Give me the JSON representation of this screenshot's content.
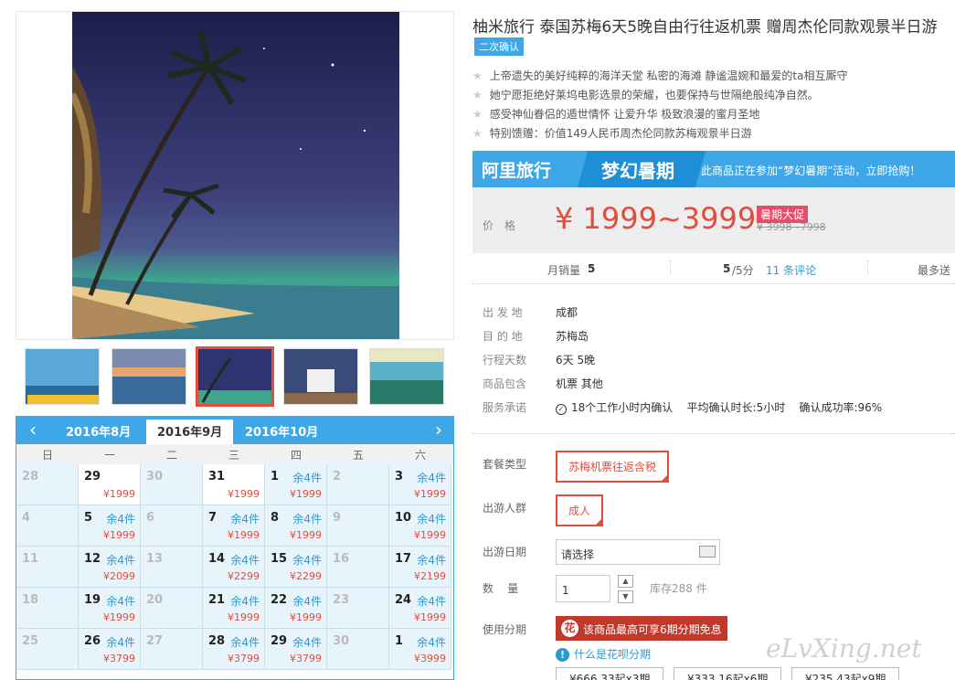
{
  "title": "柚米旅行 泰国苏梅6天5晚自由行往返机票 赠周杰伦同款观景半日游",
  "confirm_badge": "二次确认",
  "features": [
    "上帝遗失的美好纯粹的海洋天堂 私密的海滩 静谧温婉和最爱的ta相互厮守",
    "她宁愿拒绝好莱坞电影选景的荣耀，也要保持与世隔绝般纯净自然。",
    "感受神仙眷侣的遁世情怀 让爱升华 极致浪漫的蜜月圣地",
    "特别馈赠：价值149人民币周杰伦同款苏梅观景半日游"
  ],
  "promo": {
    "brand": "阿里旅行",
    "campaign": "梦幻暑期",
    "text": "此商品正在参加“梦幻暑期”活动，立即抢购！",
    "accent": "#3ea7e8"
  },
  "price": {
    "label": "价格",
    "value": "¥ 1999~3999",
    "tag": "暑期大促",
    "original": "¥ 3998~7998"
  },
  "stats": {
    "sales_label": "月销量",
    "sales": "5",
    "score": "5",
    "score_suffix": "/5分",
    "reviews": "11 条评论",
    "more": "最多送"
  },
  "details": [
    {
      "label": "出 发 地",
      "value": "成都"
    },
    {
      "label": "目 的 地",
      "value": "苏梅岛"
    },
    {
      "label": "行程天数",
      "value": "6天 5晚"
    },
    {
      "label": "商品包含",
      "value": "机票  其他"
    },
    {
      "label": "服务承诺",
      "value": "18个工作小时内确认    平均确认时长:5小时    确认成功率:96%"
    }
  ],
  "options": {
    "package_label": "套餐类型",
    "package_value": "苏梅机票往返含税",
    "crowd_label": "出游人群",
    "crowd_value": "成人",
    "date_label": "出游日期",
    "date_placeholder": "请选择",
    "qty_label": "数    量",
    "qty_value": "1",
    "stock": "库存288 件",
    "installment_label": "使用分期",
    "installment_text": "该商品最高可享6期分期免息",
    "huabei_link": "什么是花呗分期",
    "plans": [
      "¥666.33起x3期",
      "¥333.16起x6期",
      "¥235.43起x9期"
    ]
  },
  "calendar": {
    "prev": "‹",
    "next": "›",
    "months": [
      "2016年8月",
      "2016年9月",
      "2016年10月"
    ],
    "weekdays": [
      "日",
      "一",
      "二",
      "三",
      "四",
      "五",
      "六"
    ],
    "weeks": [
      [
        {
          "d": "28",
          "gray": true
        },
        {
          "d": "29",
          "s": "",
          "p": "¥1999"
        },
        {
          "d": "30",
          "gray": true
        },
        {
          "d": "31",
          "s": "",
          "p": "¥1999"
        },
        {
          "d": "1",
          "s": "余4件",
          "p": "¥1999"
        },
        {
          "d": "2",
          "gray": true
        },
        {
          "d": "3",
          "s": "余4件",
          "p": "¥1999"
        }
      ],
      [
        {
          "d": "4",
          "gray": true
        },
        {
          "d": "5",
          "s": "余4件",
          "p": "¥1999"
        },
        {
          "d": "6",
          "gray": true
        },
        {
          "d": "7",
          "s": "余4件",
          "p": "¥1999"
        },
        {
          "d": "8",
          "s": "余4件",
          "p": "¥1999"
        },
        {
          "d": "9",
          "gray": true
        },
        {
          "d": "10",
          "s": "余4件",
          "p": "¥1999"
        }
      ],
      [
        {
          "d": "11",
          "gray": true
        },
        {
          "d": "12",
          "s": "余4件",
          "p": "¥2099"
        },
        {
          "d": "13",
          "gray": true
        },
        {
          "d": "14",
          "s": "余4件",
          "p": "¥2299"
        },
        {
          "d": "15",
          "s": "余4件",
          "p": "¥2299"
        },
        {
          "d": "16",
          "gray": true
        },
        {
          "d": "17",
          "s": "余4件",
          "p": "¥2199"
        }
      ],
      [
        {
          "d": "18",
          "gray": true
        },
        {
          "d": "19",
          "s": "余4件",
          "p": "¥1999"
        },
        {
          "d": "20",
          "gray": true
        },
        {
          "d": "21",
          "s": "余4件",
          "p": "¥1999"
        },
        {
          "d": "22",
          "s": "余4件",
          "p": "¥1999"
        },
        {
          "d": "23",
          "gray": true
        },
        {
          "d": "24",
          "s": "余4件",
          "p": "¥1999"
        }
      ],
      [
        {
          "d": "25",
          "gray": true
        },
        {
          "d": "26",
          "s": "余4件",
          "p": "¥3799"
        },
        {
          "d": "27",
          "gray": true
        },
        {
          "d": "28",
          "s": "余4件",
          "p": "¥3799"
        },
        {
          "d": "29",
          "s": "余4件",
          "p": "¥3799"
        },
        {
          "d": "30",
          "gray": true
        },
        {
          "d": "1",
          "s": "余4件",
          "p": "¥3999"
        }
      ]
    ]
  },
  "watermark": "eLvXing.net"
}
